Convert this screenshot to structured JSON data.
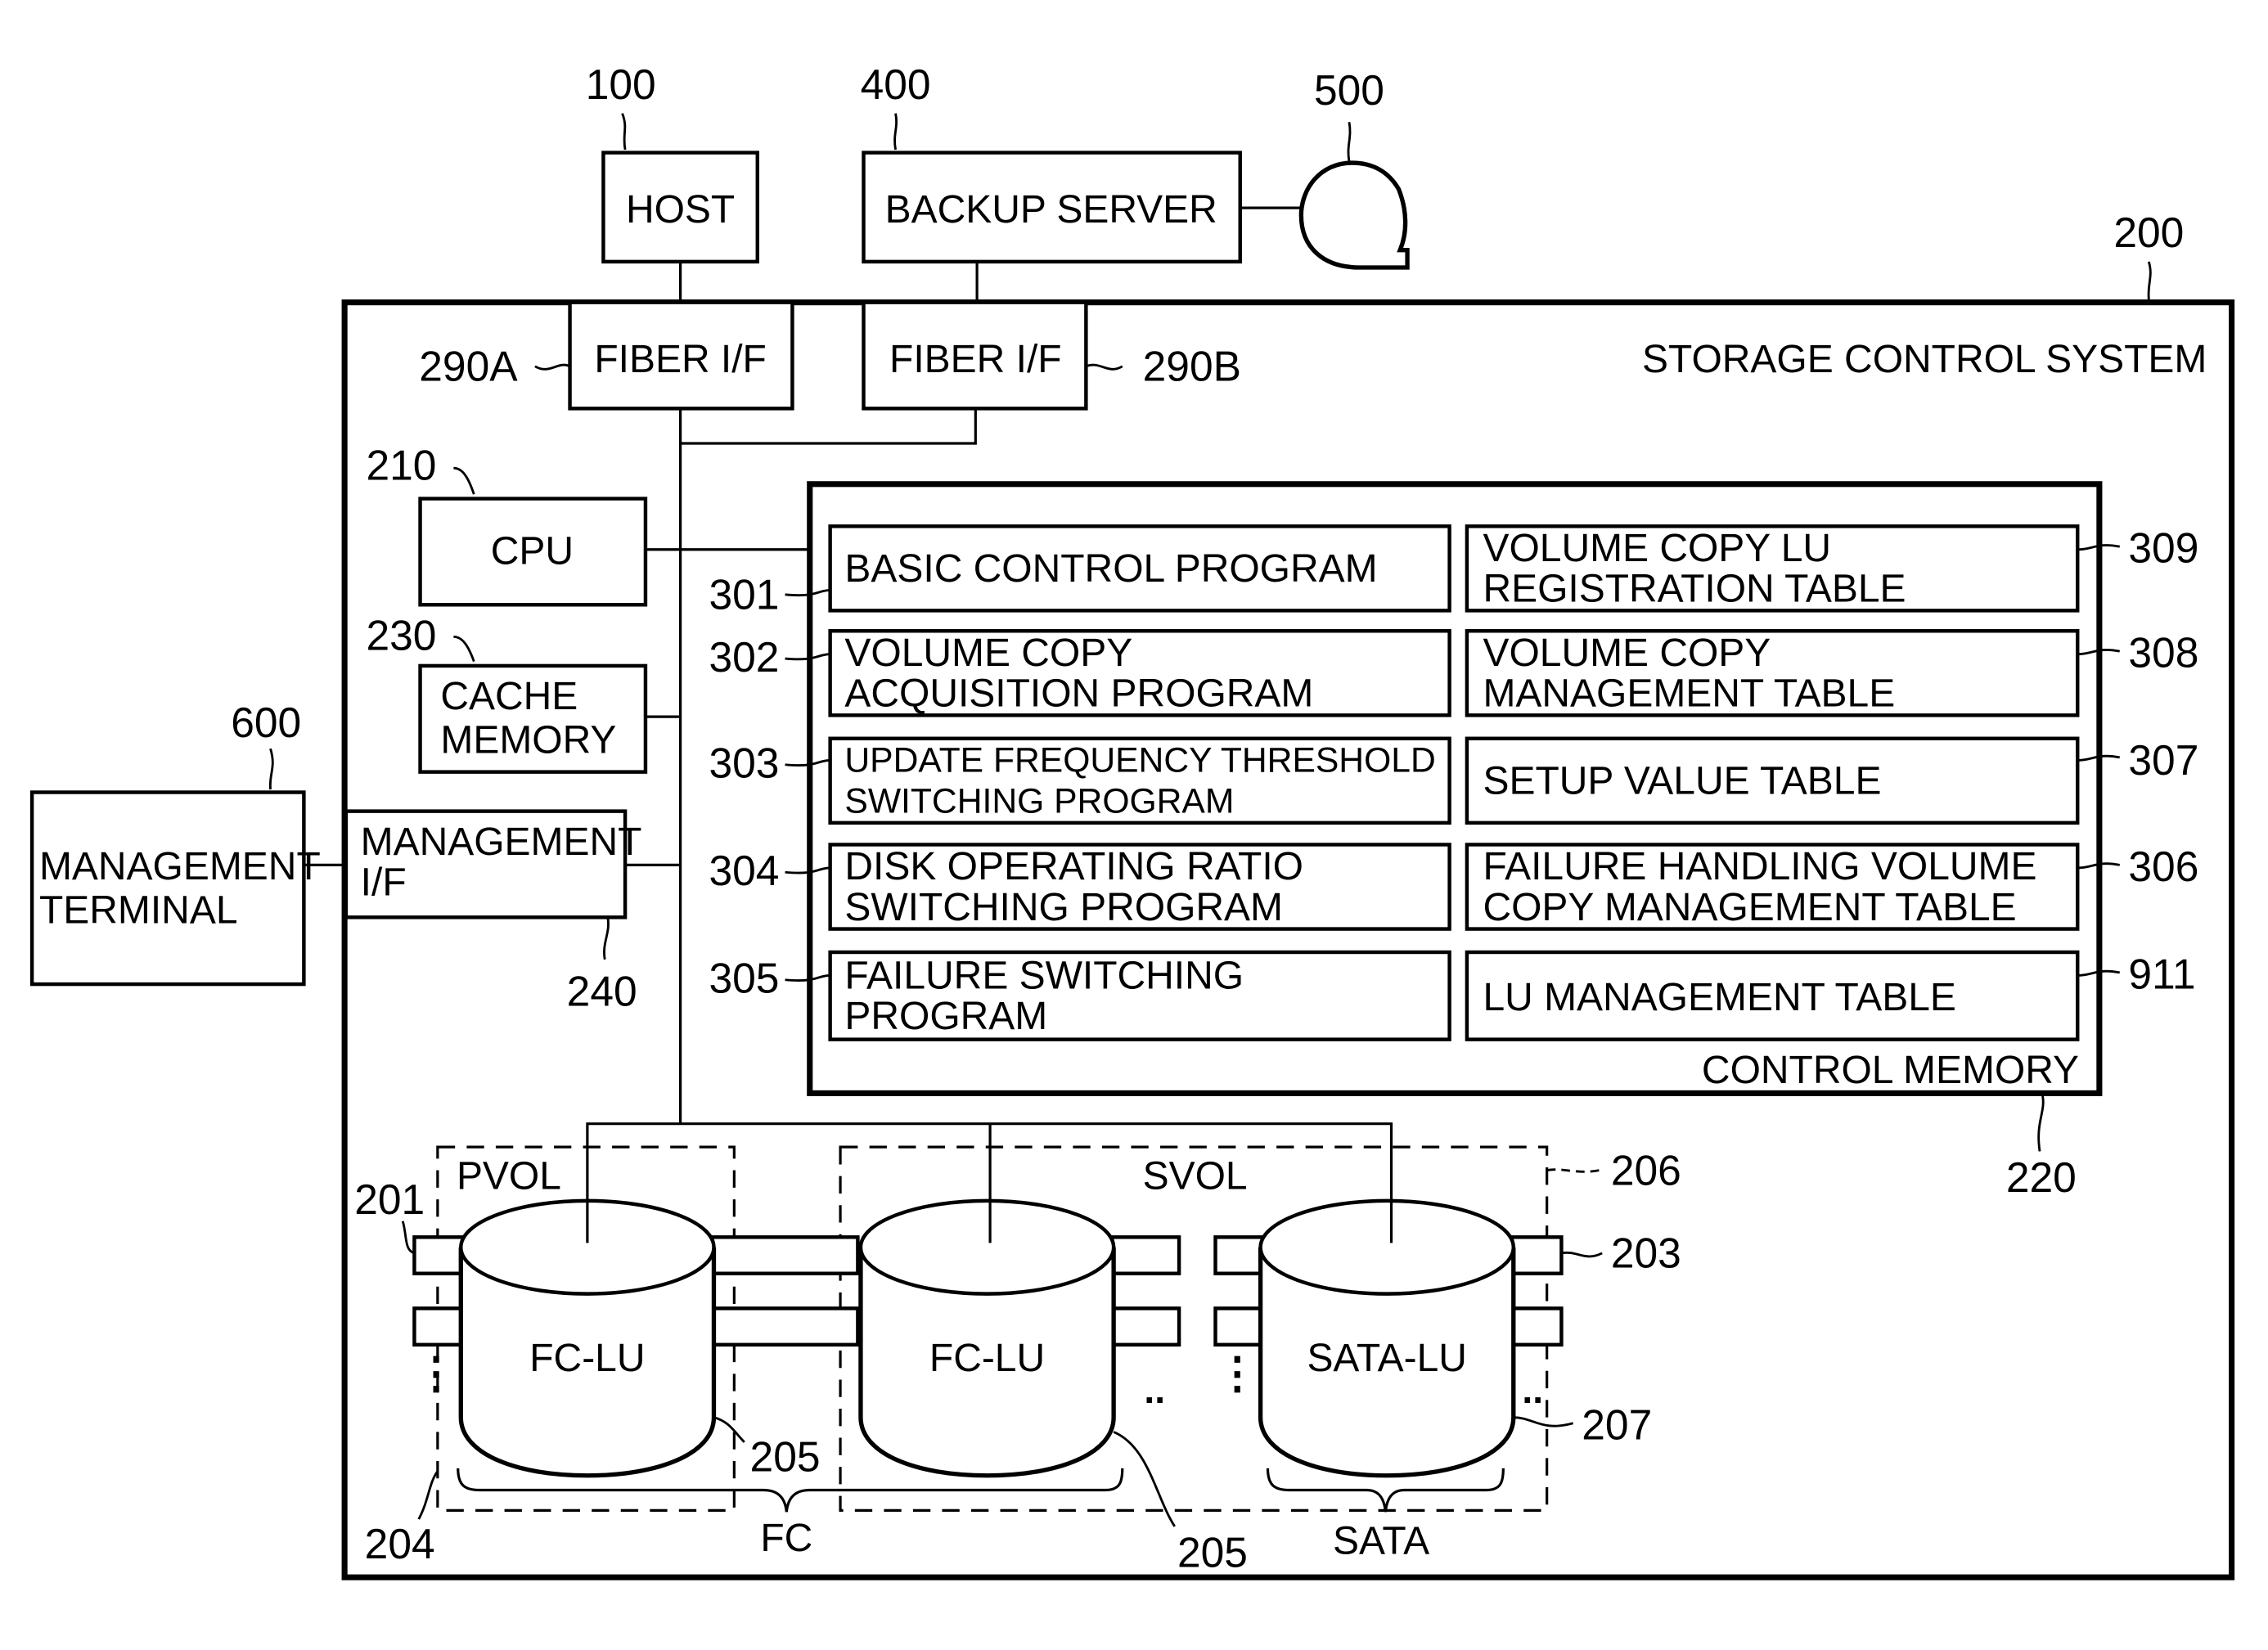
{
  "figure": {
    "external": {
      "host": {
        "label": "HOST",
        "ref": "100"
      },
      "backup_server": {
        "label": "BACKUP SERVER",
        "ref": "400"
      },
      "tape": {
        "ref": "500"
      },
      "management_terminal": {
        "line1": "MANAGEMENT",
        "line2": "TERMINAL",
        "ref": "600"
      }
    },
    "storage_system": {
      "title": "STORAGE CONTROL SYSTEM",
      "ref": "200",
      "fiber_if_a": {
        "label": "FIBER I/F",
        "ref": "290A"
      },
      "fiber_if_b": {
        "label": "FIBER I/F",
        "ref": "290B"
      },
      "cpu": {
        "label": "CPU",
        "ref": "210"
      },
      "cache": {
        "line1": "CACHE",
        "line2": "MEMORY",
        "ref": "230"
      },
      "mgmt_if": {
        "line1": "MANAGEMENT",
        "line2": "I/F",
        "ref": "240"
      },
      "control_memory": {
        "title": "CONTROL MEMORY",
        "ref": "220",
        "programs": [
          {
            "ref": "301",
            "line1": "BASIC CONTROL PROGRAM",
            "line2": ""
          },
          {
            "ref": "302",
            "line1": "VOLUME COPY",
            "line2": "ACQUISITION PROGRAM"
          },
          {
            "ref": "303",
            "line1": "UPDATE FREQUENCY THRESHOLD",
            "line2": "SWITCHING PROGRAM"
          },
          {
            "ref": "304",
            "line1": "DISK OPERATING RATIO",
            "line2": "SWITCHING PROGRAM"
          },
          {
            "ref": "305",
            "line1": "FAILURE SWITCHING",
            "line2": "PROGRAM"
          }
        ],
        "tables": [
          {
            "ref": "309",
            "line1": "VOLUME COPY LU",
            "line2": "REGISTRATION TABLE"
          },
          {
            "ref": "308",
            "line1": "VOLUME COPY",
            "line2": "MANAGEMENT TABLE"
          },
          {
            "ref": "307",
            "line1": "SETUP VALUE TABLE",
            "line2": ""
          },
          {
            "ref": "306",
            "line1": "FAILURE HANDLING VOLUME",
            "line2": "COPY MANAGEMENT TABLE"
          },
          {
            "ref": "911",
            "line1": "LU MANAGEMENT TABLE",
            "line2": ""
          }
        ]
      },
      "disks": {
        "pvol_label": "PVOL",
        "svol_label": "SVOL",
        "lus": [
          {
            "label": "FC-LU"
          },
          {
            "label": "FC-LU"
          },
          {
            "label": "SATA-LU"
          }
        ],
        "group_fc": "FC",
        "group_sata": "SATA",
        "refs": {
          "r201": "201",
          "r203": "203",
          "r204": "204",
          "r205a": "205",
          "r205b": "205",
          "r206": "206",
          "r207": "207"
        }
      }
    }
  }
}
